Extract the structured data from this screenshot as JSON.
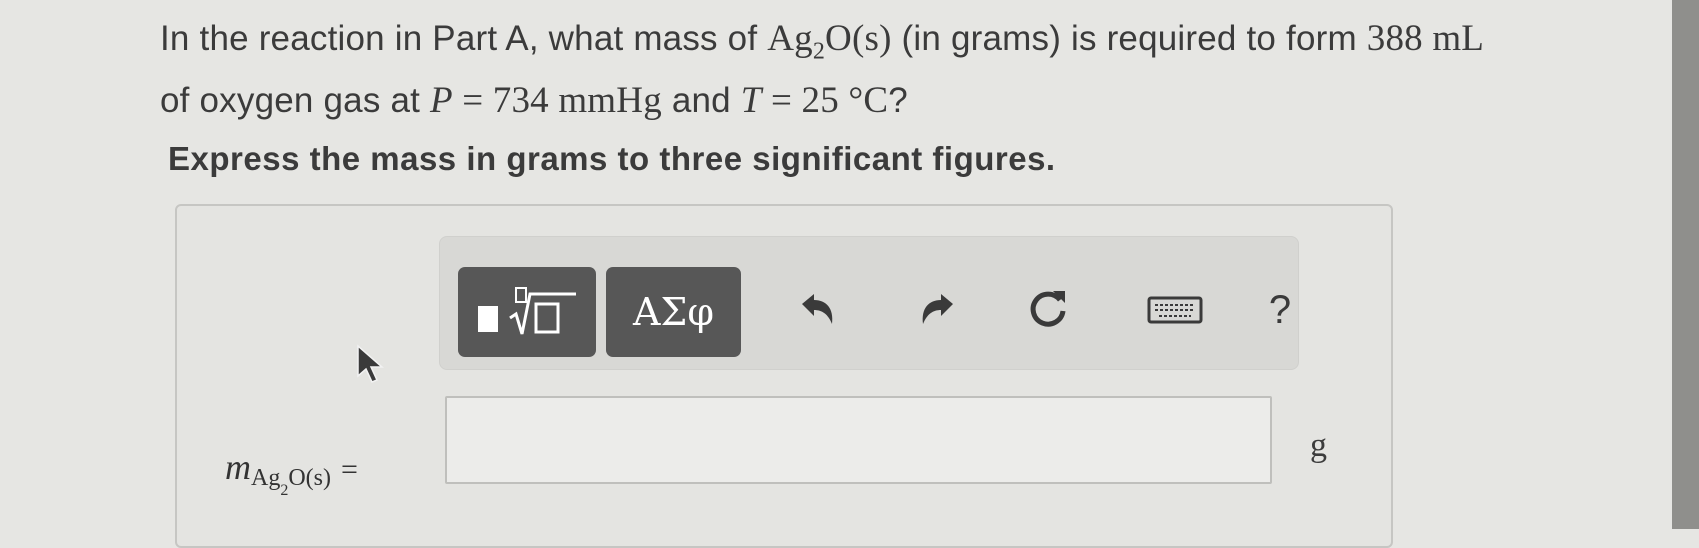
{
  "question": {
    "part1": "In the reaction in Part A, what mass of",
    "species": "Ag",
    "species_sub": "2",
    "species_rest": "O(s)",
    "part2": "(in grams) is required to form",
    "volume": "388 mL",
    "part3": "of oxygen gas at",
    "pressure_var": "P",
    "pressure_val": "= 734 mmHg",
    "part4": "and",
    "temp_var": "T",
    "temp_val": "= 25 °C",
    "end": "?"
  },
  "instruction": "Express the mass in grams to three significant figures.",
  "toolbar": {
    "greek_label": "ΑΣφ",
    "help_label": "?"
  },
  "answer": {
    "label_var": "m",
    "label_sub": "Ag",
    "label_sub2": "2",
    "label_sub_rest": "O(s)",
    "label_eq": "=",
    "value": "",
    "unit": "g"
  },
  "colors": {
    "background": "#e6e6e3",
    "toolbar_button": "#575757",
    "text": "#3b3b3b"
  }
}
